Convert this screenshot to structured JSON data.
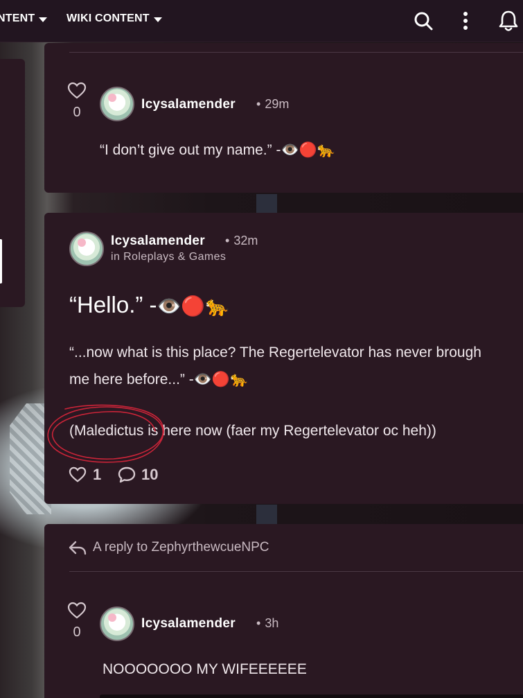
{
  "topbar": {
    "nav": [
      {
        "label": "NTENT"
      },
      {
        "label": "WIKI CONTENT"
      }
    ],
    "icons": [
      "search-icon",
      "more-vertical-icon",
      "bell-icon"
    ]
  },
  "comment_top": {
    "username": "Icysalamender",
    "time": "29m",
    "likes": "0",
    "text": "“I don’t give out my name.” -",
    "emojis": "👁️🔴🐆"
  },
  "post": {
    "username": "Icysalamender",
    "time": "32m",
    "community": "in Roleplays & Games",
    "title": "“Hello.” -",
    "title_emojis": "👁️🔴🐆",
    "line1": "“...now what is this place? The Regertelevator has never brough",
    "line2": "me here before...” -",
    "line2_emojis": "👁️🔴🐆",
    "line3": "(Maledictus is here now (faer my Regertelevator oc heh))",
    "likes": "1",
    "comments": "10"
  },
  "reply_card": {
    "reply_label": "A reply to ZephyrthewcueNPC",
    "username": "Icysalamender",
    "time": "3h",
    "likes": "0",
    "text": "NOOOOOOO MY WIFEEEEEE"
  },
  "colors": {
    "card_bg": "#2a1822",
    "topbar_bg": "#221520",
    "scribble": "#d3253a"
  }
}
